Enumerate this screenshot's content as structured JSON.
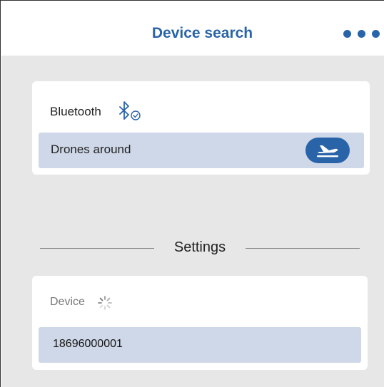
{
  "header": {
    "title": "Device search",
    "more_icon": "more-horizontal-icon"
  },
  "bluetooth_card": {
    "label": "Bluetooth",
    "status_icon": "bluetooth-connected-icon",
    "drones_label": "Drones around",
    "drones_icon": "airplane-takeoff-icon"
  },
  "settings": {
    "title": "Settings"
  },
  "device_card": {
    "label": "Device",
    "status_icon": "loading-spinner-icon",
    "value": "18696000001"
  },
  "colors": {
    "accent": "#2a64a8",
    "background": "#e7e7e7",
    "row_highlight": "#cfd8e8"
  }
}
